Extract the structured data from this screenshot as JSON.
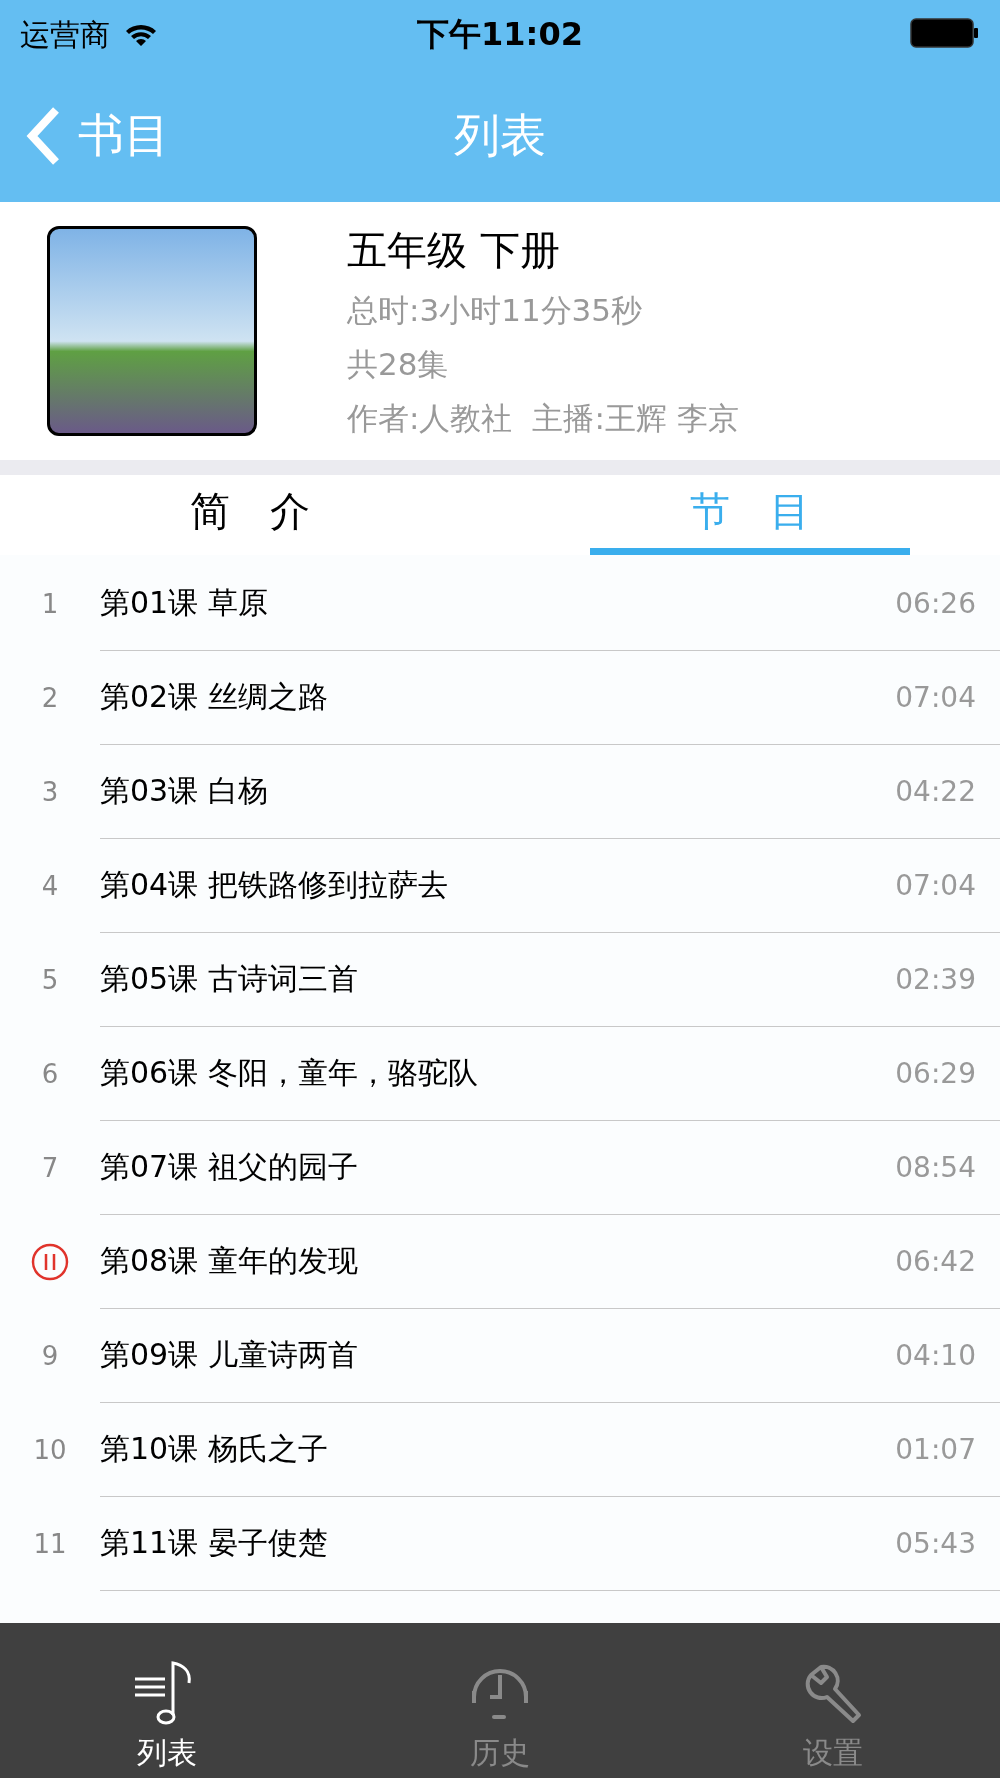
{
  "status_bar": {
    "carrier": "运营商",
    "time": "下午11:02"
  },
  "nav": {
    "back": "书目",
    "title": "列表"
  },
  "book": {
    "title": "五年级 下册",
    "total_time": "总时:3小时11分35秒",
    "episodes": "共28集",
    "author": "作者:人教社",
    "narrator": "主播:王辉 李京"
  },
  "segments": [
    {
      "label": "简　介",
      "selected": false
    },
    {
      "label": "节　目",
      "selected": true
    }
  ],
  "lessons": [
    {
      "number": "1",
      "title": "第01课 草原",
      "duration": "06:26",
      "playing": false
    },
    {
      "number": "2",
      "title": "第02课 丝绸之路",
      "duration": "07:04",
      "playing": false
    },
    {
      "number": "3",
      "title": "第03课 白杨",
      "duration": "04:22",
      "playing": false
    },
    {
      "number": "4",
      "title": "第04课 把铁路修到拉萨去",
      "duration": "07:04",
      "playing": false
    },
    {
      "number": "5",
      "title": "第05课 古诗词三首",
      "duration": "02:39",
      "playing": false
    },
    {
      "number": "6",
      "title": "第06课 冬阳，童年，骆驼队",
      "duration": "06:29",
      "playing": false
    },
    {
      "number": "7",
      "title": "第07课 祖父的园子",
      "duration": "08:54",
      "playing": false
    },
    {
      "title": "第08课 童年的发现",
      "duration": "06:42",
      "playing": true
    },
    {
      "number": "9",
      "title": "第09课 儿童诗两首",
      "duration": "04:10",
      "playing": false
    },
    {
      "number": "10",
      "title": "第10课 杨氏之子",
      "duration": "01:07",
      "playing": false
    },
    {
      "number": "11",
      "title": "第11课 晏子使楚",
      "duration": "05:43",
      "playing": false
    }
  ],
  "tab_bar": [
    {
      "kind": "list",
      "label": "列表",
      "selected": true
    },
    {
      "kind": "history",
      "label": "历史",
      "selected": false
    },
    {
      "kind": "settings",
      "label": "设置",
      "selected": false
    }
  ]
}
